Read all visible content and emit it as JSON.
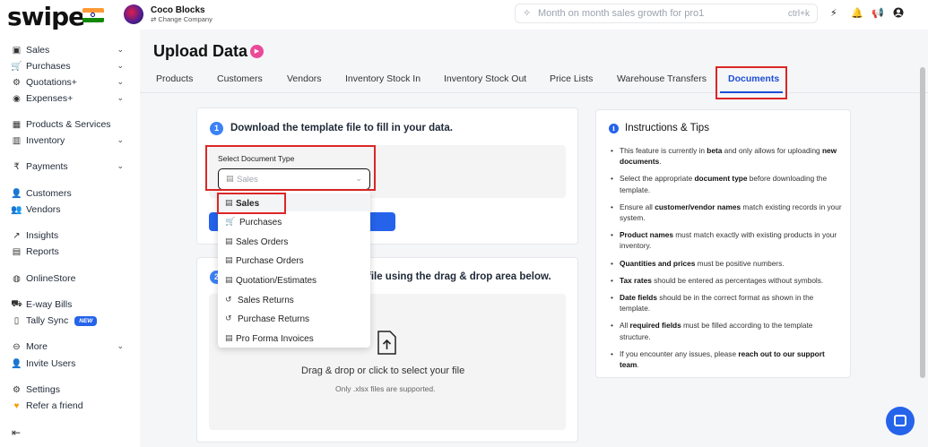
{
  "app": {
    "logo": "swipe",
    "company_name": "Coco Blocks",
    "company_change": "Change Company",
    "search_placeholder": "Month on month sales growth for pro1",
    "search_shortcut": "ctrl+k"
  },
  "sidebar": {
    "items": [
      {
        "label": "Sales",
        "icon": "cash-icon",
        "chevron": true
      },
      {
        "label": "Purchases",
        "icon": "cart-icon",
        "chevron": true
      },
      {
        "label": "Quotations+",
        "icon": "quote-icon",
        "chevron": true
      },
      {
        "label": "Expenses+",
        "icon": "wallet-icon",
        "chevron": true
      },
      {
        "label": "Products & Services",
        "icon": "box-icon",
        "chevron": false
      },
      {
        "label": "Inventory",
        "icon": "inventory-icon",
        "chevron": true
      },
      {
        "label": "Payments",
        "icon": "rupee-icon",
        "chevron": true
      },
      {
        "label": "Customers",
        "icon": "user-icon",
        "chevron": false
      },
      {
        "label": "Vendors",
        "icon": "users-icon",
        "chevron": false
      },
      {
        "label": "Insights",
        "icon": "chart-icon",
        "chevron": false
      },
      {
        "label": "Reports",
        "icon": "report-icon",
        "chevron": false
      },
      {
        "label": "OnlineStore",
        "icon": "globe-icon",
        "chevron": false
      },
      {
        "label": "E-way Bills",
        "icon": "truck-icon",
        "chevron": false
      },
      {
        "label": "Tally Sync",
        "icon": "file-icon",
        "chevron": false
      },
      {
        "label": "More",
        "icon": "more-icon",
        "chevron": true
      },
      {
        "label": "Invite Users",
        "icon": "user-plus-icon",
        "chevron": false
      },
      {
        "label": "Settings",
        "icon": "gear-icon",
        "chevron": false
      },
      {
        "label": "Refer a friend",
        "icon": "heart-icon",
        "chevron": false
      }
    ],
    "new_badge": "NEW"
  },
  "main": {
    "title": "Upload Data",
    "tabs": [
      {
        "label": "Products"
      },
      {
        "label": "Customers"
      },
      {
        "label": "Vendors"
      },
      {
        "label": "Inventory Stock In"
      },
      {
        "label": "Inventory Stock Out"
      },
      {
        "label": "Price Lists"
      },
      {
        "label": "Warehouse Transfers"
      },
      {
        "label": "Documents"
      }
    ],
    "active_tab": "Documents",
    "step1": {
      "number": "1",
      "title": "Download the template file to fill in your data."
    },
    "step2": {
      "number": "2",
      "title": "file using the drag & drop area below."
    },
    "select_label": "Select Document Type",
    "select_value": "Sales",
    "dropdown_options": [
      {
        "label": "Sales",
        "icon": "doc-icon"
      },
      {
        "label": "Purchases",
        "icon": "cart-icon"
      },
      {
        "label": "Sales Orders",
        "icon": "doc-icon"
      },
      {
        "label": "Purchase Orders",
        "icon": "doc-icon"
      },
      {
        "label": "Quotation/Estimates",
        "icon": "doc-icon"
      },
      {
        "label": "Sales Returns",
        "icon": "return-icon"
      },
      {
        "label": "Purchase Returns",
        "icon": "return-icon"
      },
      {
        "label": "Pro Forma Invoices",
        "icon": "doc-icon"
      }
    ],
    "drop_title": "Drag & drop or click to select your file",
    "drop_sub": "Only .xlsx files are supported."
  },
  "instructions": {
    "title": "Instructions & Tips",
    "tips": [
      [
        {
          "t": "This feature is currently in "
        },
        {
          "t": "beta",
          "b": true
        },
        {
          "t": " and only allows for uploading "
        },
        {
          "t": "new documents",
          "b": true
        },
        {
          "t": "."
        }
      ],
      [
        {
          "t": "Select the appropriate "
        },
        {
          "t": "document type",
          "b": true
        },
        {
          "t": " before downloading the template."
        }
      ],
      [
        {
          "t": "Ensure all "
        },
        {
          "t": "customer/vendor names",
          "b": true
        },
        {
          "t": " match existing records in your system."
        }
      ],
      [
        {
          "t": "Product names",
          "b": true
        },
        {
          "t": " must match exactly with existing products in your inventory."
        }
      ],
      [
        {
          "t": "Quantities and prices",
          "b": true
        },
        {
          "t": " must be positive numbers."
        }
      ],
      [
        {
          "t": "Tax rates",
          "b": true
        },
        {
          "t": " should be entered as percentages without symbols."
        }
      ],
      [
        {
          "t": "Date fields",
          "b": true
        },
        {
          "t": " should be in the correct format as shown in the template."
        }
      ],
      [
        {
          "t": "All "
        },
        {
          "t": "required fields",
          "b": true
        },
        {
          "t": " must be filled according to the template structure."
        }
      ],
      [
        {
          "t": "If you encounter any issues, please "
        },
        {
          "t": "reach out to our support team",
          "b": true
        },
        {
          "t": "."
        }
      ]
    ]
  },
  "colors": {
    "accent": "#2563eb",
    "highlight": "#dc2626",
    "play": "#ec4899"
  }
}
